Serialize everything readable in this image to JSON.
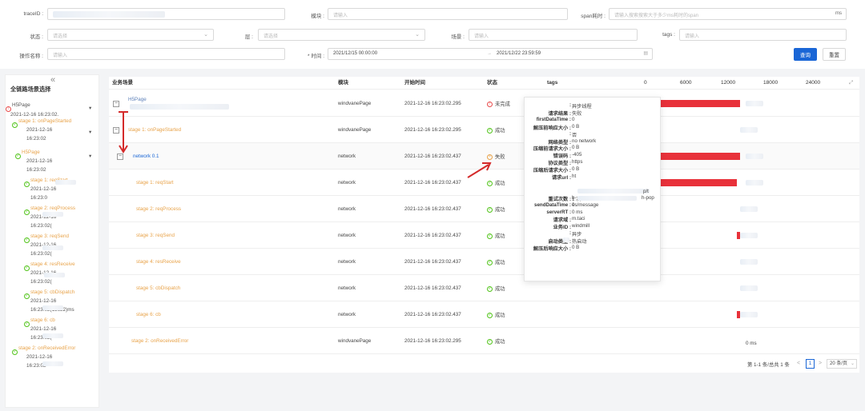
{
  "filters": {
    "traceid_label": "traceID :",
    "module_label": "模块 :",
    "module_placeholder": "请输入",
    "span_label": "span耗时 :",
    "span_placeholder": "请输入搜索搜索大于多少ms耗时的span",
    "span_unit": "ms",
    "status_label": "状态 :",
    "status_placeholder": "请选择",
    "layer_label": "层 :",
    "layer_placeholder": "请选择",
    "scene_label": "场景 :",
    "scene_placeholder": "请输入",
    "tags_label": "tags :",
    "tags_placeholder": "请输入",
    "opname_label": "操作名称 :",
    "opname_placeholder": "请输入",
    "time_label": "* 时间 :",
    "time_start": "2021/12/15 00:00:00",
    "time_sep": "→",
    "time_end": "2021/12/22 23:59:59",
    "query_button": "查询",
    "reset_button": "重置"
  },
  "sidebar": {
    "collapse": "«",
    "title": "全链路场景选择",
    "nodes": [
      {
        "text": "H5Page",
        "cls": "gray"
      },
      {
        "text": "2021-12-16 16:23:02.",
        "cls": "gray"
      },
      {
        "text": "stage 1: onPageStarted",
        "cls": "orange"
      },
      {
        "text": "2021-12-16",
        "cls": "gray"
      },
      {
        "text": "16:23:02",
        "cls": "gray"
      },
      {
        "text": "H5Page",
        "cls": "orange"
      },
      {
        "text": "2021-12-16",
        "cls": "gray"
      },
      {
        "text": "16:23:02",
        "cls": "gray"
      },
      {
        "text": "stage 1: reqStart",
        "cls": "orange"
      },
      {
        "text": "2021-12-16",
        "cls": "gray"
      },
      {
        "text": "16:23:0",
        "cls": "gray"
      },
      {
        "text": "stage 2: reqProcess",
        "cls": "orange"
      },
      {
        "text": "2021-12-16",
        "cls": "gray"
      },
      {
        "text": "16:23:02(",
        "cls": "gray"
      },
      {
        "text": "stage 3: reqSend",
        "cls": "orange"
      },
      {
        "text": "2021-12-16",
        "cls": "gray"
      },
      {
        "text": "16:23:02(",
        "cls": "gray"
      },
      {
        "text": "stage 4: resReceive",
        "cls": "orange"
      },
      {
        "text": "2021-12-16",
        "cls": "gray"
      },
      {
        "text": "16:23:02(",
        "cls": "gray"
      },
      {
        "text": "stage 5: cbDispatch",
        "cls": "orange"
      },
      {
        "text": "2021-12-16",
        "cls": "gray"
      },
      {
        "text": "16:23:02(13622)ms",
        "cls": "gray"
      },
      {
        "text": "stage 6: cb",
        "cls": "orange"
      },
      {
        "text": "2021-12-16",
        "cls": "gray"
      },
      {
        "text": "16:23:02(",
        "cls": "gray"
      },
      {
        "text": "stage 2: onReceivedError",
        "cls": "orange"
      },
      {
        "text": "2021-12-16",
        "cls": "gray"
      },
      {
        "text": "16:23:02",
        "cls": "gray"
      }
    ]
  },
  "table": {
    "headers": [
      "业务场景",
      "模块",
      "开始时间",
      "状态",
      "tags",
      "0",
      "6000",
      "12000",
      "18000",
      "24000"
    ],
    "rows": [
      {
        "scene": "H5Page",
        "module": "windvanePage",
        "time": "2021-12-16 16:23:02.295",
        "status": "未完成",
        "status_type": "warn"
      },
      {
        "scene": "stage 1: onPageStarted",
        "module": "windvanePage",
        "time": "2021-12-16 16:23:02.295",
        "status": "成功",
        "status_type": "ok"
      },
      {
        "scene": "network 0.1",
        "module": "network",
        "time": "2021-12-16 16:23:02.437",
        "status": "失败",
        "status_type": "fail"
      },
      {
        "scene": "stage 1: reqStart",
        "module": "network",
        "time": "2021-12-16 16:23:02.437",
        "status": "成功",
        "status_type": "ok"
      },
      {
        "scene": "stage 2: reqProcess",
        "module": "network",
        "time": "2021-12-16 16:23:02.437",
        "status": "成功",
        "status_type": "ok"
      },
      {
        "scene": "stage 3: reqSend",
        "module": "network",
        "time": "2021-12-16 16:23:02.437",
        "status": "成功",
        "status_type": "ok"
      },
      {
        "scene": "stage 4: resReceive",
        "module": "network",
        "time": "2021-12-16 16:23:02.437",
        "status": "成功",
        "status_type": "ok"
      },
      {
        "scene": "stage 5: cbDispatch",
        "module": "network",
        "time": "2021-12-16 16:23:02.437",
        "status": "成功",
        "status_type": "ok"
      },
      {
        "scene": "stage 6: cb",
        "module": "network",
        "time": "2021-12-16 16:23:02.437",
        "status": "成功",
        "status_type": "ok"
      },
      {
        "scene": "stage 2: onReceivedError",
        "module": "windvanePage",
        "time": "2021-12-16 16:23:02.295",
        "status": "成功",
        "status_type": "ok"
      }
    ],
    "last_row_duration": "0 ms"
  },
  "pagination": {
    "summary": "第 1-1 条/总共 1 条",
    "prev": "<",
    "page": "1",
    "next": ">",
    "page_size": "20 条/页"
  },
  "tooltip": {
    "rows": [
      {
        "k": ":",
        "v": "异步线程"
      },
      {
        "k": "请求结果 :",
        "v": "失败"
      },
      {
        "k": "firstDataTime :",
        "v": "0"
      },
      {
        "k": "解压前响应大小 :",
        "v": "0  B"
      },
      {
        "k": ":",
        "v": "否"
      },
      {
        "k": "网络类型 :",
        "v": "no network"
      },
      {
        "k": "压缩前请求大小 :",
        "v": "0  B"
      },
      {
        "k": "错误码 :",
        "v": "-405"
      },
      {
        "k": "协议类型 :",
        "v": "https"
      },
      {
        "k": "压缩后请求大小 :",
        "v": "0  B"
      },
      {
        "k": "请求url :",
        "v": "ht"
      },
      {
        "k": "",
        "v": ""
      },
      {
        "k": "",
        "v": ""
      },
      {
        "k": "重试次数 :",
        "v": "1  次"
      },
      {
        "k": "sendDataTime :",
        "v": "0"
      },
      {
        "k": "serverRT :",
        "v": "0  ms"
      },
      {
        "k": "请求域 :",
        "v": "m.taci"
      },
      {
        "k": "业务ID :",
        "v": "windmill"
      },
      {
        "k": ":",
        "v": "异步"
      },
      {
        "k": "启动类型 :",
        "v": "热启动"
      },
      {
        "k": "解压后响应大小 :",
        "v": "0  B"
      }
    ],
    "url_frag1": "p/t",
    "url_frag2": "h-pop",
    "url_frag3": "b-",
    "url_frag4": "es/message"
  },
  "colors": {
    "accent": "#1a66d6",
    "bar": "#e8313a",
    "orange": "#e8a34a",
    "ok": "#52c41a",
    "fail": "#e8a34a",
    "warn": "#e84a4a"
  }
}
